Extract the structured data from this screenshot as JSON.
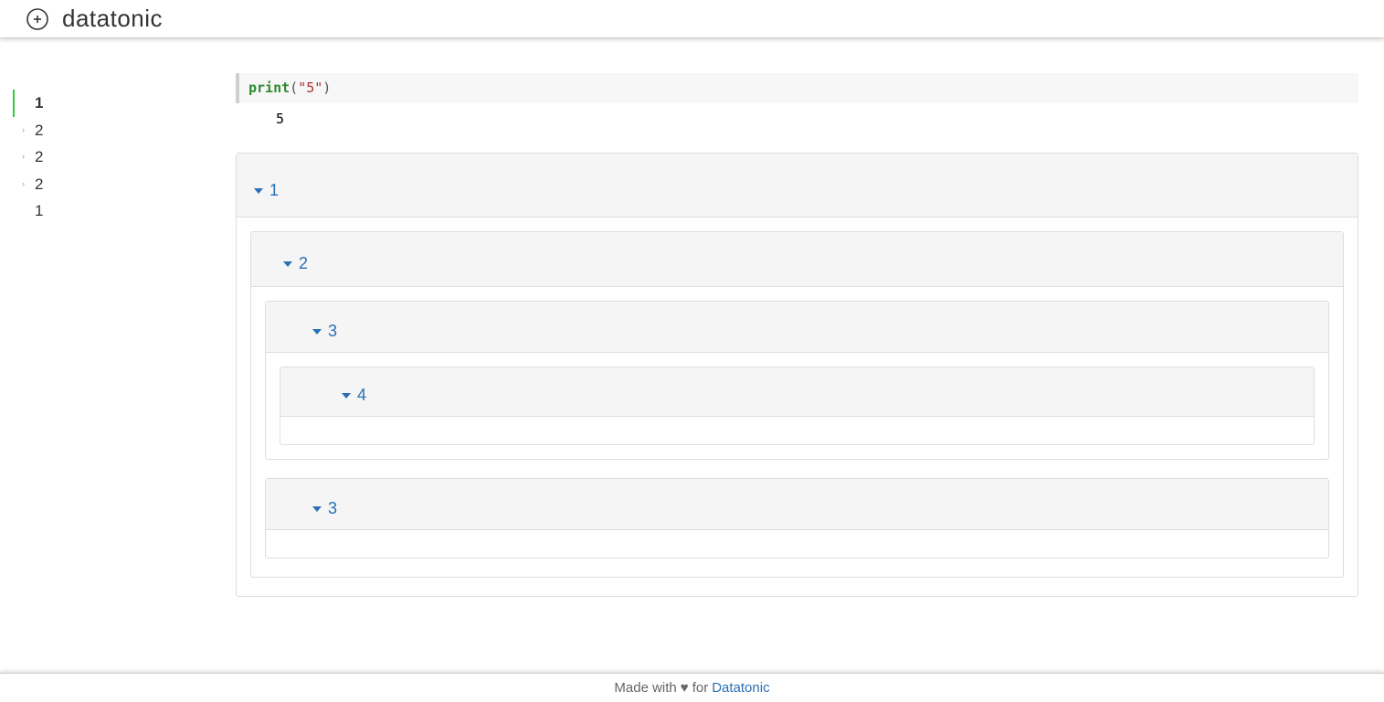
{
  "header": {
    "brand": "datatonic"
  },
  "toc": [
    {
      "label": "1",
      "active": true,
      "hasCaret": false
    },
    {
      "label": "2",
      "active": false,
      "hasCaret": true
    },
    {
      "label": "2",
      "active": false,
      "hasCaret": true
    },
    {
      "label": "2",
      "active": false,
      "hasCaret": true
    },
    {
      "label": "1",
      "active": false,
      "hasCaret": false
    }
  ],
  "code": {
    "func": "print",
    "open": "(",
    "str": "\"5\"",
    "close": ")",
    "output": "5"
  },
  "panels": {
    "p1": {
      "title": "1"
    },
    "p2": {
      "title": "2"
    },
    "p3a": {
      "title": "3"
    },
    "p4": {
      "title": "4"
    },
    "p3b": {
      "title": "3"
    }
  },
  "footer": {
    "prefix": "Made with",
    "heart": "♥",
    "mid": "for",
    "link": "Datatonic"
  }
}
